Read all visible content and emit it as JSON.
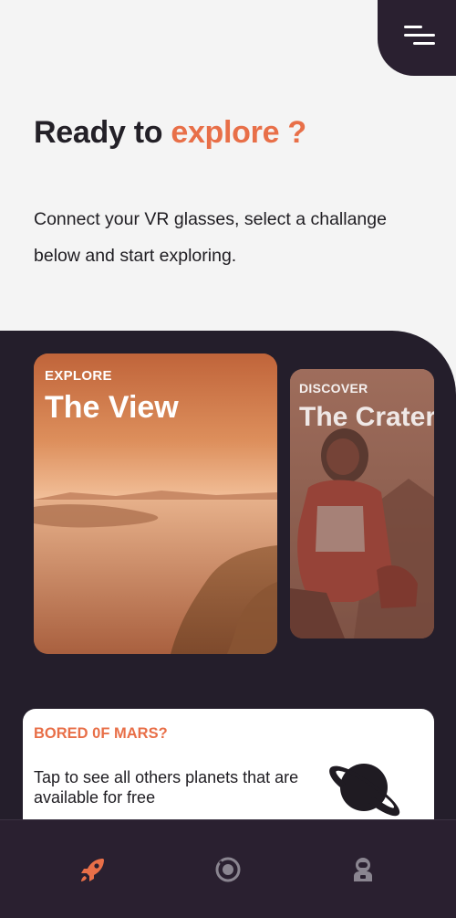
{
  "header": {
    "menu_icon": "menu-icon"
  },
  "hero": {
    "title_prefix": "Ready to ",
    "title_accent": "explore ?",
    "description": "Connect your VR glasses, select a challange below and start exploring."
  },
  "cards": [
    {
      "kicker": "EXPLORE",
      "title": "The View"
    },
    {
      "kicker": "DISCOVER",
      "title": "The Crater"
    }
  ],
  "promo": {
    "title": "BORED 0F MARS?",
    "text": "Tap to see all others planets that are available for free",
    "icon": "planet-icon"
  },
  "bottom_nav": {
    "items": [
      {
        "icon": "rocket-icon",
        "active": true
      },
      {
        "icon": "target-icon",
        "active": false
      },
      {
        "icon": "astronaut-icon",
        "active": false
      }
    ]
  },
  "colors": {
    "accent": "#e86f48",
    "dark": "#241e2b",
    "nav": "#2a2030",
    "background": "#f4f4f4",
    "inactive_icon": "#8a8590"
  }
}
